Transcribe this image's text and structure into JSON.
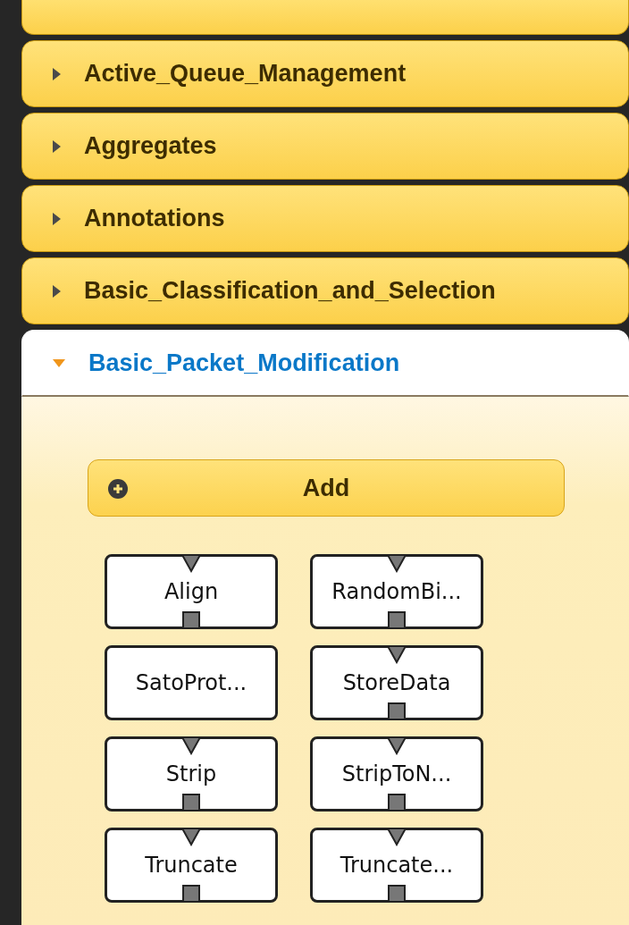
{
  "categories": [
    {
      "label": "Active_Queue_Management",
      "expanded": false
    },
    {
      "label": "Aggregates",
      "expanded": false
    },
    {
      "label": "Annotations",
      "expanded": false
    },
    {
      "label": "Basic_Classification_and_Selection",
      "expanded": false
    },
    {
      "label": "Basic_Packet_Modification",
      "expanded": true,
      "add_button": "Add",
      "elements": [
        {
          "name": "Align",
          "input": true,
          "output": true
        },
        {
          "name": "RandomBi...",
          "input": true,
          "output": true
        },
        {
          "name": "SatoProt...",
          "input": false,
          "output": false
        },
        {
          "name": "StoreData",
          "input": true,
          "output": true
        },
        {
          "name": "Strip",
          "input": true,
          "output": true
        },
        {
          "name": "StripToN...",
          "input": true,
          "output": true
        },
        {
          "name": "Truncate",
          "input": true,
          "output": true
        },
        {
          "name": "Truncate...",
          "input": true,
          "output": true
        }
      ]
    }
  ]
}
